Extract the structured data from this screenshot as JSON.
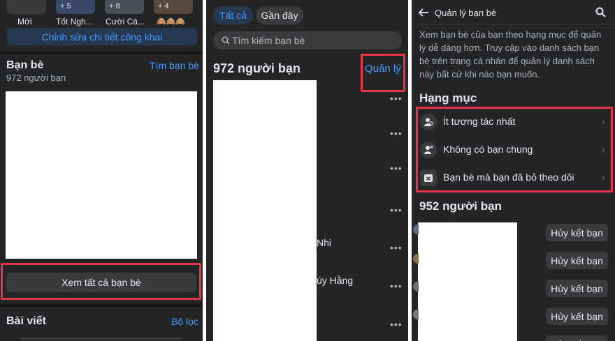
{
  "panel1": {
    "top_labels": [
      "Mới",
      "Tốt Ngh...",
      "Cười Cá...",
      "🙈🙈🙈"
    ],
    "top_badges": [
      "+ 5",
      "+ 8",
      "+ 4"
    ],
    "edit_public_button": "Chỉnh sửa chi tiết công khai",
    "friends_title": "Bạn bè",
    "friends_count": "972 người bạn",
    "find_friends_link": "Tìm bạn bè",
    "see_all_button": "Xem tất cả bạn bè",
    "posts_title": "Bài viết",
    "filter_link": "Bộ lọc"
  },
  "panel2": {
    "tabs": [
      "Tất cả",
      "Gần đây"
    ],
    "search_placeholder": "Tìm kiếm bạn bè",
    "friends_count": "972 người bạn",
    "manage_link": "Quản lý",
    "partial_names": [
      "Nhi",
      "úy Hằng"
    ]
  },
  "panel3": {
    "header_title": "Quản lý bạn bè",
    "description": "Xem bạn bè của bạn theo hạng mục để quản lý dễ dàng hơn. Truy cập vào danh sách bạn bè trên trang cá nhân để quản lý danh sách này bất cứ khi nào bạn muốn.",
    "categories_title": "Hạng mục",
    "categories": [
      "Ít tương tác nhất",
      "Không có bạn chung",
      "Bạn bè mà bạn đã bỏ theo dõi"
    ],
    "friends_count": "952 người bạn",
    "unfriend_button": "Hủy kết bạn"
  },
  "colors": {
    "accent": "#4599ff",
    "highlight": "#e7344a",
    "background": "#242526"
  }
}
